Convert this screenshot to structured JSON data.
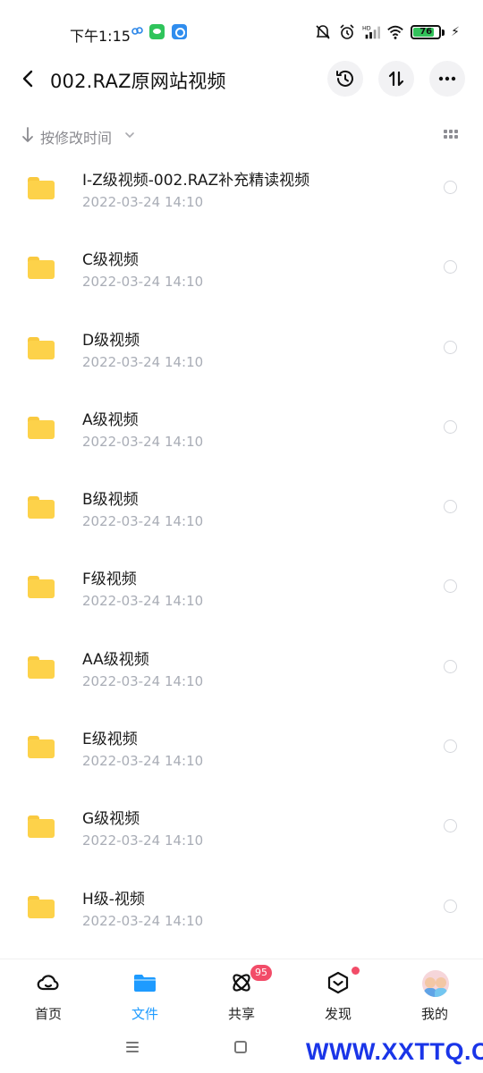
{
  "status_bar": {
    "time": "下午1:15",
    "battery_level": "76",
    "icons": [
      "cloud-icon",
      "wechat-icon",
      "app-icon",
      "mute-icon",
      "alarm-icon",
      "hd-signal-icon",
      "wifi-icon",
      "battery-icon",
      "charging-icon"
    ]
  },
  "header": {
    "title": "002.RAZ原网站视频",
    "icons": [
      "back-icon",
      "history-icon",
      "sort-icon",
      "more-icon"
    ]
  },
  "sort": {
    "label": "按修改时间"
  },
  "files": [
    {
      "name": "I-Z级视频-002.RAZ补充精读视频",
      "date": "2022-03-24  14:10"
    },
    {
      "name": "C级视频",
      "date": "2022-03-24  14:10"
    },
    {
      "name": "D级视频",
      "date": "2022-03-24  14:10"
    },
    {
      "name": "A级视频",
      "date": "2022-03-24  14:10"
    },
    {
      "name": "B级视频",
      "date": "2022-03-24  14:10"
    },
    {
      "name": "F级视频",
      "date": "2022-03-24  14:10"
    },
    {
      "name": "AA级视频",
      "date": "2022-03-24  14:10"
    },
    {
      "name": "E级视频",
      "date": "2022-03-24  14:10"
    },
    {
      "name": "G级视频",
      "date": "2022-03-24  14:10"
    },
    {
      "name": "H级-视频",
      "date": "2022-03-24  14:10"
    }
  ],
  "bottom_nav": {
    "items": [
      {
        "label": "首页",
        "icon": "cloud-home-icon"
      },
      {
        "label": "文件",
        "icon": "folder-icon",
        "active": true
      },
      {
        "label": "共享",
        "icon": "atom-share-icon",
        "badge": "95"
      },
      {
        "label": "发现",
        "icon": "discover-icon",
        "dot": true
      },
      {
        "label": "我的",
        "icon": "avatar-icon"
      }
    ]
  },
  "watermark": "WWW.XXTTQ.COM",
  "colors": {
    "accent": "#1e9bff",
    "folder": "#fdd24a",
    "badge": "#f24c68",
    "watermark": "#1a35e8"
  }
}
